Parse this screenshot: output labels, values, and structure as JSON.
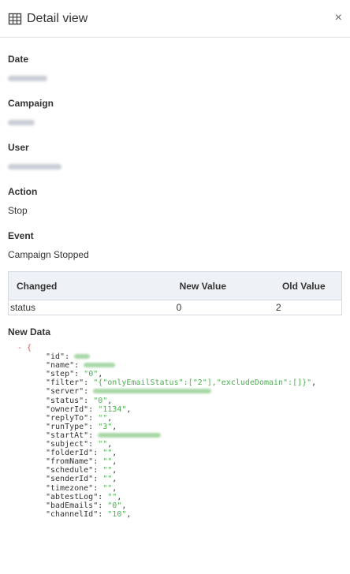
{
  "header": {
    "title": "Detail view",
    "close_label": "×"
  },
  "fields": {
    "date_label": "Date",
    "campaign_label": "Campaign",
    "user_label": "User",
    "action_label": "Action",
    "action_value": "Stop",
    "event_label": "Event",
    "event_value": "Campaign Stopped"
  },
  "changes_table": {
    "headers": [
      "Changed",
      "New Value",
      "Old Value"
    ],
    "rows": [
      [
        "status",
        "0",
        "2"
      ]
    ]
  },
  "new_data": {
    "label": "New Data",
    "toggle": "- {",
    "lines": [
      {
        "key": "\"id\"",
        "value": null
      },
      {
        "key": "\"name\"",
        "value": null
      },
      {
        "key": "\"step\"",
        "value": "\"0\""
      },
      {
        "key": "\"filter\"",
        "value": "\"{\"onlyEmailStatus\":[\"2\"],\"excludeDomain\":[]}\""
      },
      {
        "key": "\"server\"",
        "value": null
      },
      {
        "key": "\"status\"",
        "value": "\"0\""
      },
      {
        "key": "\"ownerId\"",
        "value": "\"1134\""
      },
      {
        "key": "\"replyTo\"",
        "value": "\"\""
      },
      {
        "key": "\"runType\"",
        "value": "\"3\""
      },
      {
        "key": "\"startAt\"",
        "value": null
      },
      {
        "key": "\"subject\"",
        "value": "\"\""
      },
      {
        "key": "\"folderId\"",
        "value": "\"\""
      },
      {
        "key": "\"fromName\"",
        "value": "\"\""
      },
      {
        "key": "\"schedule\"",
        "value": "\"\""
      },
      {
        "key": "\"senderId\"",
        "value": "\"\""
      },
      {
        "key": "\"timezone\"",
        "value": "\"\""
      },
      {
        "key": "\"abtestLog\"",
        "value": "\"\""
      },
      {
        "key": "\"badEmails\"",
        "value": "\"0\""
      },
      {
        "key": "\"channelId\"",
        "value": "\"10\""
      }
    ]
  }
}
